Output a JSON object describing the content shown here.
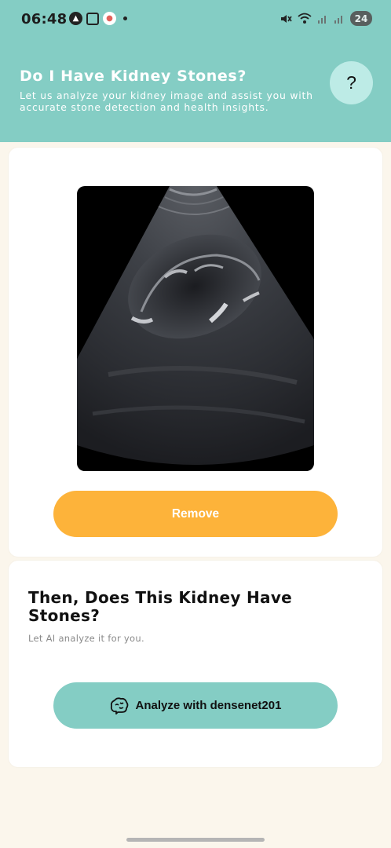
{
  "status_bar": {
    "time": "06:48",
    "battery": "24",
    "left_icons": [
      "navigation-icon",
      "screenshot-icon",
      "app-notification-icon"
    ],
    "right_icons": [
      "mute-icon",
      "wifi-icon",
      "signal-icon",
      "signal-icon"
    ]
  },
  "header": {
    "title": "Do I Have Kidney Stones?",
    "subtitle": "Let us analyze your kidney image and assist you with accurate stone detection and health insights.",
    "help_label": "?"
  },
  "image_card": {
    "image_icon": "kidney-ultrasound-image",
    "remove_label": "Remove"
  },
  "analyze_card": {
    "title": "Then, Does This Kidney Have Stones?",
    "subtitle": "Let AI analyze it for you.",
    "button_label": "Analyze with densenet201",
    "button_icon": "brain-icon"
  },
  "colors": {
    "primary": "#84cdc4",
    "accent": "#fdb33a",
    "background": "#fbf6ec"
  }
}
